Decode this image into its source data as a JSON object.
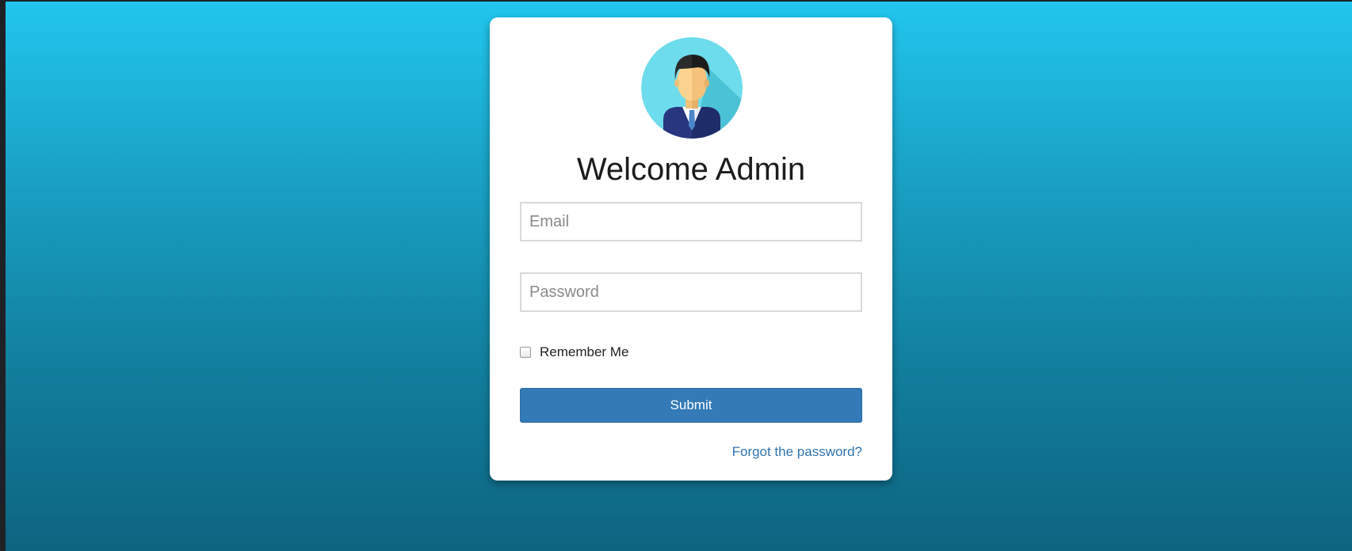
{
  "login": {
    "title": "Welcome Admin",
    "email_placeholder": "Email",
    "password_placeholder": "Password",
    "remember_label": "Remember Me",
    "submit_label": "Submit",
    "forgot_label": "Forgot the password?"
  },
  "colors": {
    "background_top": "#22c6ee",
    "background_bottom": "#0d6480",
    "button": "#337ab7",
    "link": "#2f73b0"
  },
  "icons": {
    "avatar": "businessman-avatar-icon"
  }
}
